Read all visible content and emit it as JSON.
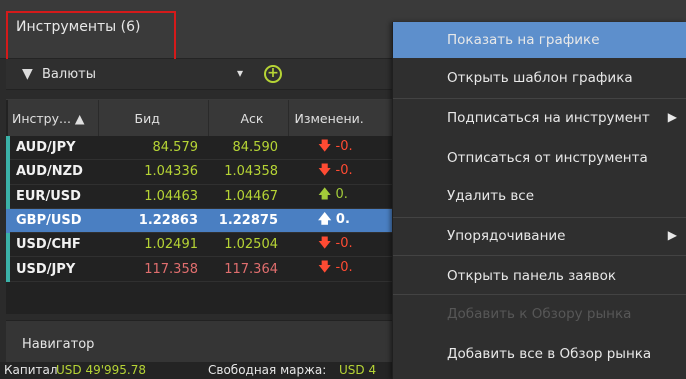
{
  "tab": {
    "label": "Инструменты (6)"
  },
  "filter": {
    "label": "Валюты",
    "add_icon": "plus-circle-icon"
  },
  "table": {
    "headers": [
      "Инстру... ▲",
      "Бид",
      "Аск",
      "Изменени."
    ],
    "rows": [
      {
        "symbol": "AUD/JPY",
        "bid": "84.579",
        "ask": "84.590",
        "change": "-0."
      },
      {
        "symbol": "AUD/NZD",
        "bid": "1.04336",
        "ask": "1.04358",
        "change": "-0."
      },
      {
        "symbol": "EUR/USD",
        "bid": "1.04463",
        "ask": "1.04467",
        "change": "0."
      },
      {
        "symbol": "GBP/USD",
        "bid": "1.22863",
        "ask": "1.22875",
        "change": "0."
      },
      {
        "symbol": "USD/CHF",
        "bid": "1.02491",
        "ask": "1.02504",
        "change": "-0."
      },
      {
        "symbol": "USD/JPY",
        "bid": "117.358",
        "ask": "117.364",
        "change": "-0."
      }
    ]
  },
  "navigator": {
    "label": "Навигатор"
  },
  "status": {
    "capital_label": "Капитал",
    "capital_value": "USD 49'995.78",
    "margin_label": "Свободная маржа:",
    "margin_value": "USD 4"
  },
  "menu": {
    "items": [
      {
        "label": "Показать на графике"
      },
      {
        "label": "Открыть шаблон графика"
      },
      {
        "label": "Подписаться на инструмент"
      },
      {
        "label": "Отписаться от инструмента"
      },
      {
        "label": "Удалить все"
      },
      {
        "label": "Упорядочивание"
      },
      {
        "label": "Открыть панель заявок"
      },
      {
        "label": "Добавить к Обзору рынка"
      },
      {
        "label": "Добавить все в Обзор рынка"
      }
    ]
  },
  "colors": {
    "accent": "#5d8fcc",
    "positive": "#b6d435",
    "negative": "#ff4b33",
    "highlight_box": "#d41a1a"
  }
}
